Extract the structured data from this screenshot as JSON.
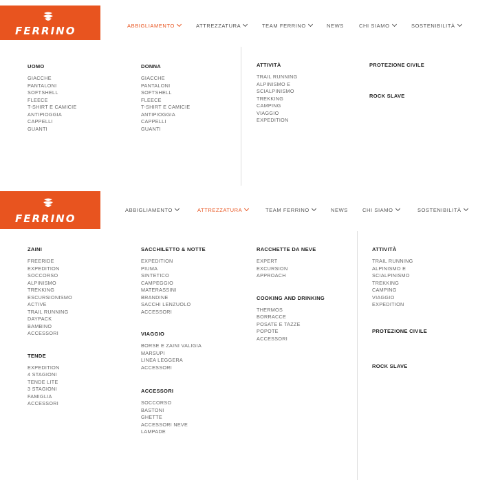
{
  "brand": {
    "name": "FERRINO",
    "color": "#e8541f"
  },
  "nav_items": [
    "ABBIGLIAMENTO",
    "ATTREZZATURA",
    "TEAM FERRINO",
    "NEWS",
    "CHI SIAMO",
    "SOSTENIBILITÀ"
  ],
  "menu1": {
    "uomo": {
      "title": "UOMO",
      "items": [
        "GIACCHE",
        "PANTALONI",
        "SOFTSHELL",
        "FLEECE",
        "T-SHIRT E CAMICIE",
        "ANTIPIOGGIA",
        "CAPPELLI",
        "GUANTI"
      ]
    },
    "donna": {
      "title": "DONNA",
      "items": [
        "GIACCHE",
        "PANTALONI",
        "SOFTSHELL",
        "FLEECE",
        "T-SHIRT E CAMICIE",
        "ANTIPIOGGIA",
        "CAPPELLI",
        "GUANTI"
      ]
    },
    "attivita": {
      "title": "ATTIVITÀ",
      "items": [
        "TRAIL RUNNING",
        "ALPINISMO E",
        "SCIALPINISMO",
        "TREKKING",
        "CAMPING",
        "VIAGGIO",
        "EXPEDITION"
      ]
    },
    "protezione_civile": "PROTEZIONE CIVILE",
    "rock_slave": "ROCK SLAVE"
  },
  "menu2": {
    "zaini": {
      "title": "ZAINI",
      "items": [
        "FREERIDE",
        "EXPEDITION",
        "SOCCORSO",
        "ALPINISMO",
        "TREKKING",
        "ESCURSIONISMO",
        "ACTIVE",
        "TRAIL RUNNING",
        "DAYPACK",
        "BAMBINO",
        "ACCESSORI"
      ]
    },
    "tende": {
      "title": "TENDE",
      "items": [
        "EXPEDITION",
        "4 STAGIONI",
        "TENDE LITE",
        "3 STAGIONI",
        "FAMIGLIA",
        "ACCESSORI"
      ]
    },
    "sacchiletto": {
      "title": "SACCHILETTO & NOTTE",
      "items": [
        "EXPEDITION",
        "PIUMA",
        "SINTETICO",
        "CAMPEGGIO",
        "MATERASSINI",
        "BRANDINE",
        "SACCHI LENZUOLO",
        "ACCESSORI"
      ]
    },
    "viaggio": {
      "title": "VIAGGIO",
      "items": [
        "BORSE E ZAINI VALIGIA",
        "MARSUPI",
        "LINEA LEGGERA",
        "ACCESSORI"
      ]
    },
    "accessori": {
      "title": "ACCESSORI",
      "items": [
        "SOCCORSO",
        "BASTONI",
        "GHETTE",
        "ACCESSORI NEVE",
        "LAMPADE"
      ]
    },
    "racchette": {
      "title": "RACCHETTE DA NEVE",
      "items": [
        "EXPERT",
        "EXCURSION",
        "APPROACH"
      ]
    },
    "cooking": {
      "title": "COOKING AND DRINKING",
      "items": [
        "THERMOS",
        "BORRACCE",
        "POSATE E TAZZE",
        "POPOTE",
        "ACCESSORI"
      ]
    },
    "attivita": {
      "title": "ATTIVITÀ",
      "items": [
        "TRAIL RUNNING",
        "ALPINISMO E",
        "SCIALPINISMO",
        "TREKKING",
        "CAMPING",
        "VIAGGIO",
        "EXPEDITION"
      ]
    },
    "protezione_civile": "PROTEZIONE CIVILE",
    "rock_slave": "ROCK SLAVE"
  }
}
